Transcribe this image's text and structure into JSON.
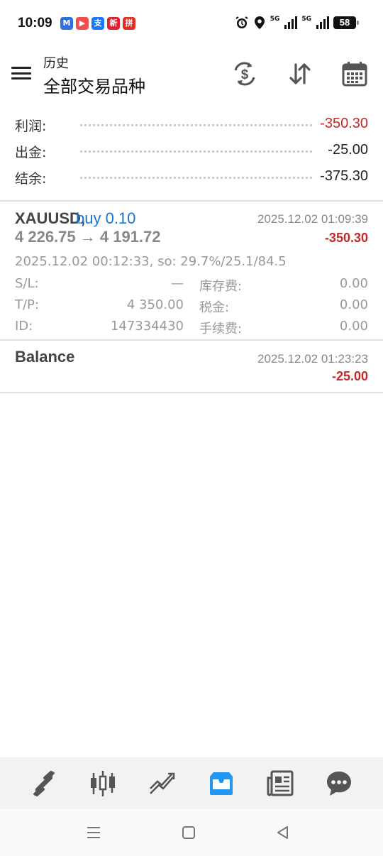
{
  "status_bar": {
    "time": "10:09",
    "battery": "58",
    "network_1": "5G",
    "network_2": "5G",
    "app_icons": [
      {
        "name": "meituan",
        "char": "M",
        "color": "#2f6fe0"
      },
      {
        "name": "video",
        "char": "▶",
        "color": "#ef4f4f"
      },
      {
        "name": "alipay",
        "char": "支",
        "color": "#1677ff"
      },
      {
        "name": "news",
        "char": "新",
        "color": "#e0202e"
      },
      {
        "name": "pinduoduo",
        "char": "拼",
        "color": "#e02e24"
      }
    ]
  },
  "header": {
    "subtitle": "历史",
    "title": "全部交易品种"
  },
  "summary": [
    {
      "label": "利润:",
      "value": "-350.30",
      "negative": true
    },
    {
      "label": "出金:",
      "value": "-25.00",
      "negative": false
    },
    {
      "label": "结余:",
      "value": "-375.30",
      "negative": false
    }
  ],
  "trade": {
    "symbol": "XAUUSD,",
    "type": "buy 0.10",
    "close_time": "2025.12.02 01:09:39",
    "prices": "4 226.75 → 4 191.72",
    "profit": "-350.30",
    "open_info": "2025.12.02 00:12:33, so: 29.7%/25.1/84.5",
    "details": [
      {
        "label": "S/L:",
        "value": "—",
        "label2": "库存费:",
        "value2": "0.00"
      },
      {
        "label": "T/P:",
        "value": "4 350.00",
        "label2": "税金:",
        "value2": "0.00"
      },
      {
        "label": "ID:",
        "value": "147334430",
        "label2": "手续费:",
        "value2": "0.00"
      }
    ]
  },
  "balance": {
    "title": "Balance",
    "time": "2025.12.02 01:23:23",
    "amount": "-25.00"
  },
  "bottom_nav": {
    "items": [
      "quotes-icon",
      "chart-icon",
      "trade-icon",
      "history-icon",
      "news-icon",
      "chat-icon"
    ],
    "active": "history-icon",
    "active_color": "#2196f3",
    "inactive_color": "#555555"
  },
  "colors": {
    "negative": "#c62828",
    "buy": "#1976d2"
  }
}
